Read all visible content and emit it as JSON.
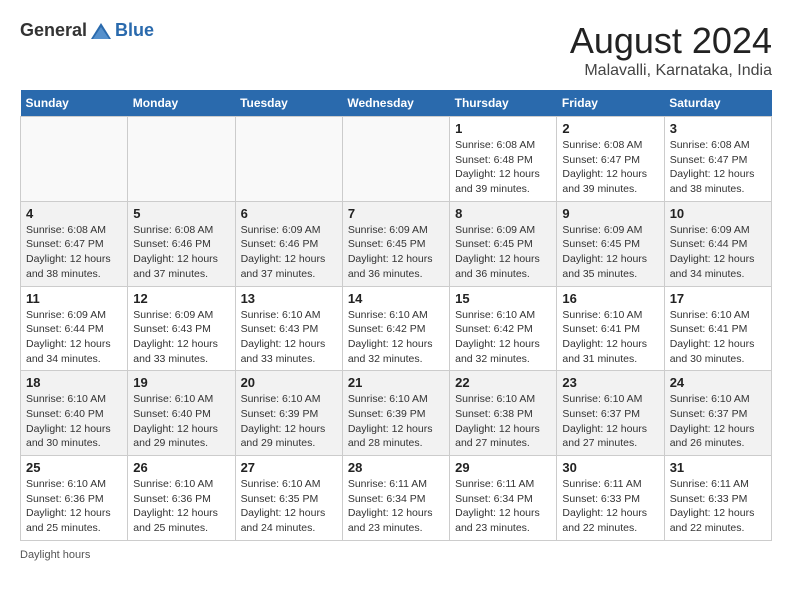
{
  "logo": {
    "general": "General",
    "blue": "Blue"
  },
  "title": "August 2024",
  "location": "Malavalli, Karnataka, India",
  "days_header": [
    "Sunday",
    "Monday",
    "Tuesday",
    "Wednesday",
    "Thursday",
    "Friday",
    "Saturday"
  ],
  "footer": "Daylight hours",
  "weeks": [
    [
      {
        "day": "",
        "info": ""
      },
      {
        "day": "",
        "info": ""
      },
      {
        "day": "",
        "info": ""
      },
      {
        "day": "",
        "info": ""
      },
      {
        "day": "1",
        "info": "Sunrise: 6:08 AM\nSunset: 6:48 PM\nDaylight: 12 hours and 39 minutes."
      },
      {
        "day": "2",
        "info": "Sunrise: 6:08 AM\nSunset: 6:47 PM\nDaylight: 12 hours and 39 minutes."
      },
      {
        "day": "3",
        "info": "Sunrise: 6:08 AM\nSunset: 6:47 PM\nDaylight: 12 hours and 38 minutes."
      }
    ],
    [
      {
        "day": "4",
        "info": "Sunrise: 6:08 AM\nSunset: 6:47 PM\nDaylight: 12 hours and 38 minutes."
      },
      {
        "day": "5",
        "info": "Sunrise: 6:08 AM\nSunset: 6:46 PM\nDaylight: 12 hours and 37 minutes."
      },
      {
        "day": "6",
        "info": "Sunrise: 6:09 AM\nSunset: 6:46 PM\nDaylight: 12 hours and 37 minutes."
      },
      {
        "day": "7",
        "info": "Sunrise: 6:09 AM\nSunset: 6:45 PM\nDaylight: 12 hours and 36 minutes."
      },
      {
        "day": "8",
        "info": "Sunrise: 6:09 AM\nSunset: 6:45 PM\nDaylight: 12 hours and 36 minutes."
      },
      {
        "day": "9",
        "info": "Sunrise: 6:09 AM\nSunset: 6:45 PM\nDaylight: 12 hours and 35 minutes."
      },
      {
        "day": "10",
        "info": "Sunrise: 6:09 AM\nSunset: 6:44 PM\nDaylight: 12 hours and 34 minutes."
      }
    ],
    [
      {
        "day": "11",
        "info": "Sunrise: 6:09 AM\nSunset: 6:44 PM\nDaylight: 12 hours and 34 minutes."
      },
      {
        "day": "12",
        "info": "Sunrise: 6:09 AM\nSunset: 6:43 PM\nDaylight: 12 hours and 33 minutes."
      },
      {
        "day": "13",
        "info": "Sunrise: 6:10 AM\nSunset: 6:43 PM\nDaylight: 12 hours and 33 minutes."
      },
      {
        "day": "14",
        "info": "Sunrise: 6:10 AM\nSunset: 6:42 PM\nDaylight: 12 hours and 32 minutes."
      },
      {
        "day": "15",
        "info": "Sunrise: 6:10 AM\nSunset: 6:42 PM\nDaylight: 12 hours and 32 minutes."
      },
      {
        "day": "16",
        "info": "Sunrise: 6:10 AM\nSunset: 6:41 PM\nDaylight: 12 hours and 31 minutes."
      },
      {
        "day": "17",
        "info": "Sunrise: 6:10 AM\nSunset: 6:41 PM\nDaylight: 12 hours and 30 minutes."
      }
    ],
    [
      {
        "day": "18",
        "info": "Sunrise: 6:10 AM\nSunset: 6:40 PM\nDaylight: 12 hours and 30 minutes."
      },
      {
        "day": "19",
        "info": "Sunrise: 6:10 AM\nSunset: 6:40 PM\nDaylight: 12 hours and 29 minutes."
      },
      {
        "day": "20",
        "info": "Sunrise: 6:10 AM\nSunset: 6:39 PM\nDaylight: 12 hours and 29 minutes."
      },
      {
        "day": "21",
        "info": "Sunrise: 6:10 AM\nSunset: 6:39 PM\nDaylight: 12 hours and 28 minutes."
      },
      {
        "day": "22",
        "info": "Sunrise: 6:10 AM\nSunset: 6:38 PM\nDaylight: 12 hours and 27 minutes."
      },
      {
        "day": "23",
        "info": "Sunrise: 6:10 AM\nSunset: 6:37 PM\nDaylight: 12 hours and 27 minutes."
      },
      {
        "day": "24",
        "info": "Sunrise: 6:10 AM\nSunset: 6:37 PM\nDaylight: 12 hours and 26 minutes."
      }
    ],
    [
      {
        "day": "25",
        "info": "Sunrise: 6:10 AM\nSunset: 6:36 PM\nDaylight: 12 hours and 25 minutes."
      },
      {
        "day": "26",
        "info": "Sunrise: 6:10 AM\nSunset: 6:36 PM\nDaylight: 12 hours and 25 minutes."
      },
      {
        "day": "27",
        "info": "Sunrise: 6:10 AM\nSunset: 6:35 PM\nDaylight: 12 hours and 24 minutes."
      },
      {
        "day": "28",
        "info": "Sunrise: 6:11 AM\nSunset: 6:34 PM\nDaylight: 12 hours and 23 minutes."
      },
      {
        "day": "29",
        "info": "Sunrise: 6:11 AM\nSunset: 6:34 PM\nDaylight: 12 hours and 23 minutes."
      },
      {
        "day": "30",
        "info": "Sunrise: 6:11 AM\nSunset: 6:33 PM\nDaylight: 12 hours and 22 minutes."
      },
      {
        "day": "31",
        "info": "Sunrise: 6:11 AM\nSunset: 6:33 PM\nDaylight: 12 hours and 22 minutes."
      }
    ]
  ]
}
